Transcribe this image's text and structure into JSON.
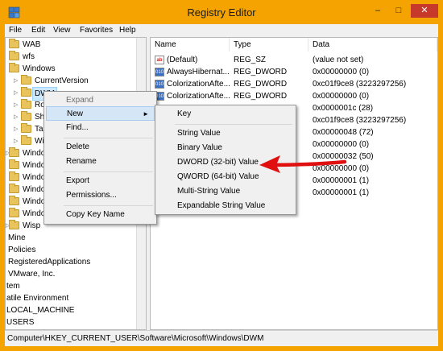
{
  "window": {
    "title": "Registry Editor",
    "minimize_glyph": "–",
    "maximize_glyph": "□",
    "close_glyph": "✕",
    "app_icon": "registry-editor-icon"
  },
  "menubar": [
    "File",
    "Edit",
    "View",
    "Favorites",
    "Help"
  ],
  "tree": {
    "items": [
      {
        "label": "WAB"
      },
      {
        "label": "wfs"
      },
      {
        "label": "Windows"
      },
      {
        "label": "CurrentVersion"
      },
      {
        "label": "DWM"
      },
      {
        "label": "Ro"
      },
      {
        "label": "Sh"
      },
      {
        "label": "Ta"
      },
      {
        "label": "Wi"
      },
      {
        "label": "Windo"
      },
      {
        "label": "Windo"
      },
      {
        "label": "Windo"
      },
      {
        "label": "Windo"
      },
      {
        "label": "Windo"
      },
      {
        "label": "Windo"
      },
      {
        "label": "Wisp"
      },
      {
        "label": "Mine"
      },
      {
        "label": "Policies"
      },
      {
        "label": "RegisteredApplications"
      },
      {
        "label": "VMware, Inc."
      },
      {
        "label": "tem"
      },
      {
        "label": "atile Environment"
      },
      {
        "label": "LOCAL_MACHINE"
      },
      {
        "label": "USERS"
      }
    ]
  },
  "list": {
    "columns": [
      "Name",
      "Type",
      "Data"
    ],
    "rows": [
      {
        "name": "(Default)",
        "type": "REG_SZ",
        "data": "(value not set)",
        "icon": "ab"
      },
      {
        "name": "AlwaysHibernat...",
        "type": "REG_DWORD",
        "data": "0x00000000 (0)",
        "icon": "010"
      },
      {
        "name": "ColorizationAfte...",
        "type": "REG_DWORD",
        "data": "0xc01f9ce8 (3223297256)",
        "icon": "010"
      },
      {
        "name": "ColorizationAfte...",
        "type": "REG_DWORD",
        "data": "0x00000000 (0)",
        "icon": "010"
      },
      {
        "name": "",
        "type": "",
        "data": "0x0000001c (28)",
        "icon": ""
      },
      {
        "name": "",
        "type": "",
        "data": "0xc01f9ce8 (3223297256)",
        "icon": ""
      },
      {
        "name": "",
        "type": "",
        "data": "0x00000048 (72)",
        "icon": ""
      },
      {
        "name": "",
        "type": "",
        "data": "0x00000000 (0)",
        "icon": ""
      },
      {
        "name": "",
        "type": "",
        "data": "0x00000032 (50)",
        "icon": ""
      },
      {
        "name": "",
        "type": "",
        "data": "0x00000000 (0)",
        "icon": ""
      },
      {
        "name": "",
        "type": "",
        "data": "0x00000001 (1)",
        "icon": ""
      },
      {
        "name": "",
        "type": "",
        "data": "0x00000001 (1)",
        "icon": ""
      }
    ]
  },
  "context_menu": {
    "items": [
      "Expand",
      "New",
      "Find...",
      "Delete",
      "Rename",
      "Export",
      "Permissions...",
      "Copy Key Name"
    ],
    "submenu_arrow": "►"
  },
  "submenu": {
    "items": [
      "Key",
      "String Value",
      "Binary Value",
      "DWORD (32-bit) Value",
      "QWORD (64-bit) Value",
      "Multi-String Value",
      "Expandable String Value"
    ]
  },
  "statusbar": {
    "path": "Computer\\HKEY_CURRENT_USER\\Software\\Microsoft\\Windows\\DWM"
  },
  "annotation": {
    "color": "#e01010"
  }
}
